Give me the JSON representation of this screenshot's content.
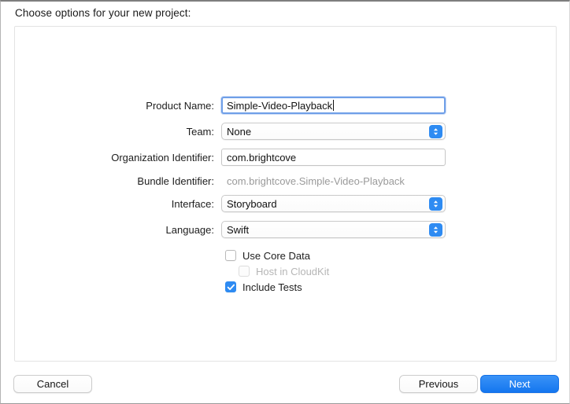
{
  "dialog": {
    "title": "Choose options for your new project:"
  },
  "form": {
    "rows": [
      {
        "label": "Product Name:",
        "value": "Simple-Video-Playback",
        "type": "textfield",
        "focused": true
      },
      {
        "label": "Team:",
        "value": "None",
        "type": "popup"
      },
      {
        "label": "Organization Identifier:",
        "value": "com.brightcove",
        "type": "textfield",
        "focused": false
      },
      {
        "label": "Bundle Identifier:",
        "value": "com.brightcove.Simple-Video-Playback",
        "type": "static"
      },
      {
        "label": "Interface:",
        "value": "Storyboard",
        "type": "popup"
      },
      {
        "label": "Language:",
        "value": "Swift",
        "type": "popup"
      }
    ],
    "checkboxes": [
      {
        "label": "Use Core Data",
        "checked": false,
        "disabled": false,
        "indented": false
      },
      {
        "label": "Host in CloudKit",
        "checked": false,
        "disabled": true,
        "indented": true
      },
      {
        "label": "Include Tests",
        "checked": true,
        "disabled": false,
        "indented": false
      }
    ]
  },
  "footer": {
    "cancel_label": "Cancel",
    "previous_label": "Previous",
    "next_label": "Next"
  },
  "colors": {
    "accent": "#2e8bf2",
    "primary_button": "#1476ef",
    "focus_ring": "#6f9fe8",
    "disabled_text": "#b6b6b6",
    "static_text": "#9a9a9a"
  }
}
